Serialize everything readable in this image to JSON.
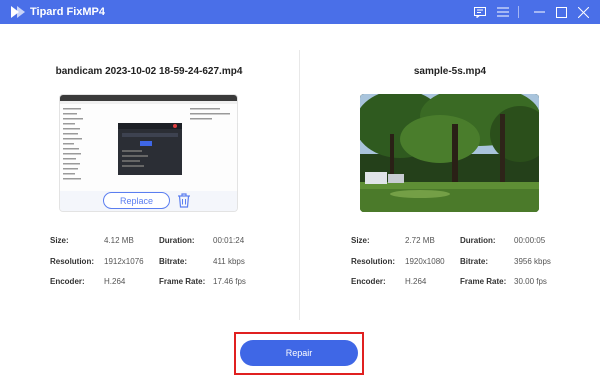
{
  "app": {
    "title": "Tipard FixMP4"
  },
  "window_controls": {
    "feedback_icon": "chat-icon",
    "menu_icon": "menu-icon",
    "minimize_icon": "minimize-icon",
    "maximize_icon": "maximize-icon",
    "close_icon": "close-icon"
  },
  "left": {
    "filename": "bandicam 2023-10-02 18-59-24-627.mp4",
    "replace_label": "Replace",
    "info": {
      "size_label": "Size:",
      "size": "4.12 MB",
      "duration_label": "Duration:",
      "duration": "00:01:24",
      "resolution_label": "Resolution:",
      "resolution": "1912x1076",
      "bitrate_label": "Bitrate:",
      "bitrate": "411 kbps",
      "encoder_label": "Encoder:",
      "encoder": "H.264",
      "framerate_label": "Frame Rate:",
      "framerate": "17.46 fps"
    }
  },
  "right": {
    "filename": "sample-5s.mp4",
    "info": {
      "size_label": "Size:",
      "size": "2.72 MB",
      "duration_label": "Duration:",
      "duration": "00:00:05",
      "resolution_label": "Resolution:",
      "resolution": "1920x1080",
      "bitrate_label": "Bitrate:",
      "bitrate": "3956 kbps",
      "encoder_label": "Encoder:",
      "encoder": "H.264",
      "framerate_label": "Frame Rate:",
      "framerate": "30.00 fps"
    }
  },
  "repair_label": "Repair",
  "colors": {
    "accent": "#3f67e6",
    "titlebar": "#4a6fe8",
    "highlight": "#e02020"
  }
}
